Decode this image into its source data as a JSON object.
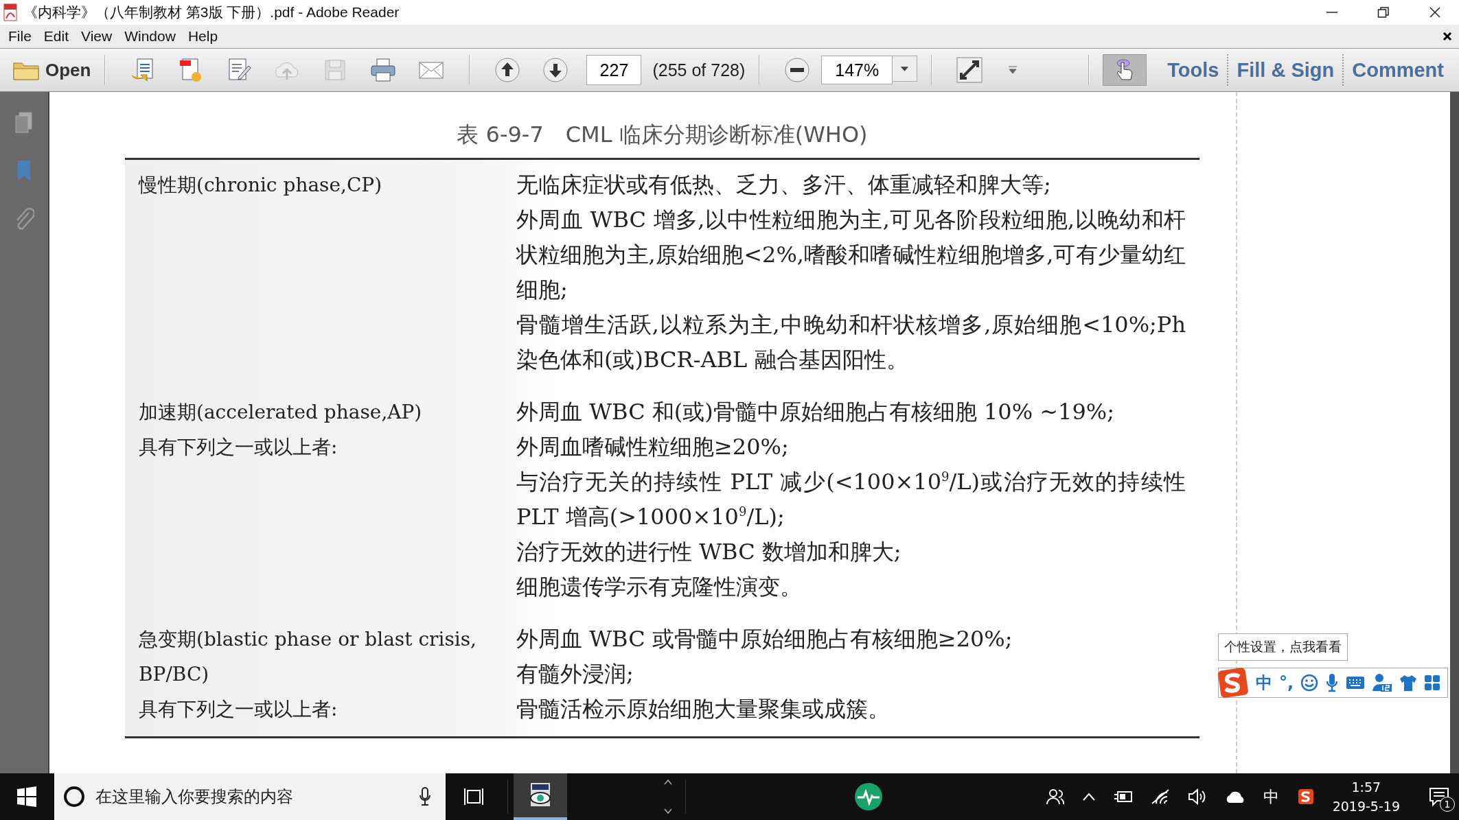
{
  "window": {
    "title": "《内科学》（八年制教材 第3版 下册）.pdf - Adobe Reader"
  },
  "menu": [
    {
      "label": "File"
    },
    {
      "label": "Edit"
    },
    {
      "label": "View"
    },
    {
      "label": "Window"
    },
    {
      "label": "Help"
    }
  ],
  "toolbar": {
    "open_label": "Open",
    "page_number": "227",
    "page_count": "(255 of 728)",
    "zoom": "147%",
    "hand_tool": {
      "selected": true
    },
    "panels": [
      {
        "label": "Tools"
      },
      {
        "label": "Fill & Sign"
      },
      {
        "label": "Comment"
      }
    ]
  },
  "document": {
    "table_title": "表 6-9-7　CML 临床分期诊断标准(WHO)",
    "rows": [
      {
        "label_lines": [
          "慢性期(chronic phase,CP)"
        ],
        "criteria": [
          "无临床症状或有低热、乏力、多汗、体重减轻和脾大等;",
          "外周血 WBC 增多,以中性粒细胞为主,可见各阶段粒细胞,以晚幼和杆状粒细胞为主,原始细胞<2%,嗜酸和嗜碱性粒细胞增多,可有少量幼红细胞;",
          "骨髓增生活跃,以粒系为主,中晚幼和杆状核增多,原始细胞<10%;Ph 染色体和(或)BCR-ABL 融合基因阳性。"
        ]
      },
      {
        "label_lines": [
          "加速期(accelerated phase,AP)",
          "具有下列之一或以上者:"
        ],
        "criteria": [
          "外周血 WBC 和(或)骨髓中原始细胞占有核细胞 10% ~19%;",
          "外周血嗜碱性粒细胞≥20%;",
          "与治疗无关的持续性 PLT 减少(<100×10$^{9}$/L)或治疗无效的持续性 PLT 增高(>1000×10$^{9}$/L);",
          "治疗无效的进行性 WBC 数增加和脾大;",
          "细胞遗传学示有克隆性演变。"
        ]
      },
      {
        "label_lines": [
          "急变期(blastic phase or blast crisis,",
          "BP/BC)",
          "具有下列之一或以上者:"
        ],
        "criteria": [
          "外周血 WBC 或骨髓中原始细胞占有核细胞≥20%;",
          "有髓外浸润;",
          "骨髓活检示原始细胞大量聚集或成簇。"
        ]
      }
    ]
  },
  "ime": {
    "tooltip": "个性设置，点我看看",
    "mode": "中",
    "punct": "°,"
  },
  "taskbar": {
    "search_placeholder": "在这里输入你要搜索的内容",
    "ime_indicator": "中",
    "time": "1:57",
    "date": "2019-5-19",
    "notification_count": "1"
  }
}
